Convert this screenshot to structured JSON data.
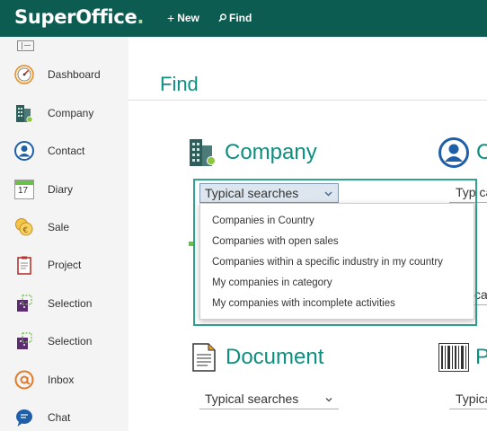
{
  "app": {
    "logo_text": "SuperOffice",
    "logo_dot": ".",
    "new_label": "New",
    "find_label": "Find",
    "brand_color": "#0d5c52",
    "accent_color": "#0d8f80"
  },
  "sidebar": {
    "items": [
      {
        "label": "Dashboard",
        "icon": "dashboard-gauge-icon"
      },
      {
        "label": "Company",
        "icon": "company-building-icon"
      },
      {
        "label": "Contact",
        "icon": "contact-person-icon"
      },
      {
        "label": "Diary",
        "icon": "diary-calendar-icon"
      },
      {
        "label": "Sale",
        "icon": "sale-coins-icon"
      },
      {
        "label": "Project",
        "icon": "project-clipboard-icon"
      },
      {
        "label": "Selection",
        "icon": "selection-icon"
      },
      {
        "label": "Selection",
        "icon": "selection-icon"
      },
      {
        "label": "Inbox",
        "icon": "inbox-at-icon"
      },
      {
        "label": "Chat",
        "icon": "chat-bubble-icon"
      }
    ],
    "diary_day": "17"
  },
  "main": {
    "title": "Find",
    "company": {
      "heading": "Company",
      "select_value": "Typical searches",
      "options": [
        "Companies in Country",
        "Companies with open sales",
        "Companies within a specific industry in my country",
        "My companies in category",
        "My companies with incomplete activities"
      ]
    },
    "contact": {
      "heading_partial": "C",
      "input_partial": "Typ ca"
    },
    "right_partial_2": "ca",
    "document": {
      "heading": "Document",
      "select_value": "Typical searches"
    },
    "product": {
      "heading_partial": "P",
      "select_partial": "Typica"
    }
  }
}
